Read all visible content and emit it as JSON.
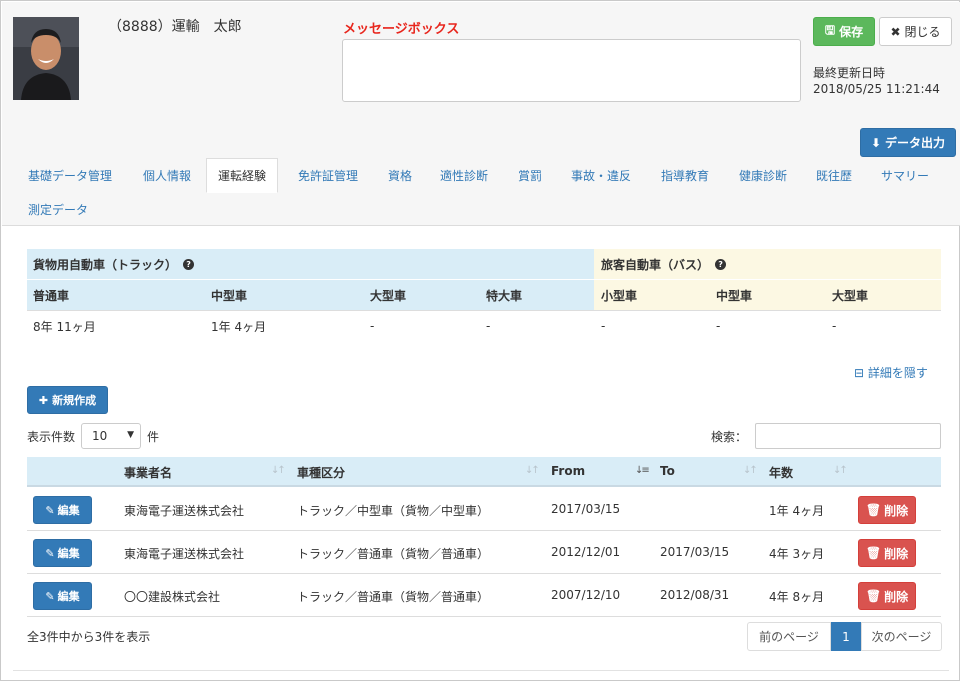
{
  "header": {
    "employee_name": "（8888）運輸　太郎",
    "message_title": "メッセージボックス",
    "save_label": "保存",
    "close_label": "閉じる",
    "last_updated_label": "最終更新日時",
    "last_updated_value": "2018/05/25 11:21:44",
    "export_label": "データ出力"
  },
  "tabs": [
    {
      "label": "基礎データ管理"
    },
    {
      "label": "個人情報"
    },
    {
      "label": "運転経験"
    },
    {
      "label": "免許証管理"
    },
    {
      "label": "資格"
    },
    {
      "label": "適性診断"
    },
    {
      "label": "賞罰"
    },
    {
      "label": "事故・違反"
    },
    {
      "label": "指導教育"
    },
    {
      "label": "健康診断"
    },
    {
      "label": "既往歴"
    },
    {
      "label": "サマリー"
    },
    {
      "label": "測定データ"
    }
  ],
  "active_tab": "運転経験",
  "experience": {
    "truck_title": "貨物用自動車（トラック）",
    "bus_title": "旅客自動車（バス）",
    "headers": [
      "普通車",
      "中型車",
      "大型車",
      "特大車",
      "小型車",
      "中型車",
      "大型車"
    ],
    "values": [
      "8年 11ヶ月",
      "1年 4ヶ月",
      "-",
      "-",
      "-",
      "-",
      "-"
    ]
  },
  "detail_toggle": "詳細を隠す",
  "new_button": "新規作成",
  "page_size": {
    "label": "表示件数",
    "value": "10",
    "unit": "件"
  },
  "search": {
    "label": "検索："
  },
  "table": {
    "columns": [
      "事業者名",
      "車種区分",
      "From",
      "To",
      "年数"
    ],
    "edit_label": "編集",
    "delete_label": "削除",
    "rows": [
      {
        "company": "東海電子運送株式会社",
        "type": "トラック／中型車（貨物／中型車）",
        "from": "2017/03/15",
        "to": "",
        "years": "1年 4ヶ月"
      },
      {
        "company": "東海電子運送株式会社",
        "type": "トラック／普通車（貨物／普通車）",
        "from": "2012/12/01",
        "to": "2017/03/15",
        "years": "4年 3ヶ月"
      },
      {
        "company": "〇〇建設株式会社",
        "type": "トラック／普通車（貨物／普通車）",
        "from": "2007/12/10",
        "to": "2012/08/31",
        "years": "4年 8ヶ月"
      }
    ]
  },
  "footer": {
    "info": "全3件中から3件を表示",
    "prev": "前のページ",
    "current": "1",
    "next": "次のページ"
  },
  "colors": {
    "primary": "#337ab7",
    "success": "#5cb85c",
    "danger": "#d9534f",
    "message": "#e8261d",
    "info_bg": "#d9edf7",
    "warning_bg": "#fcf8e3"
  }
}
